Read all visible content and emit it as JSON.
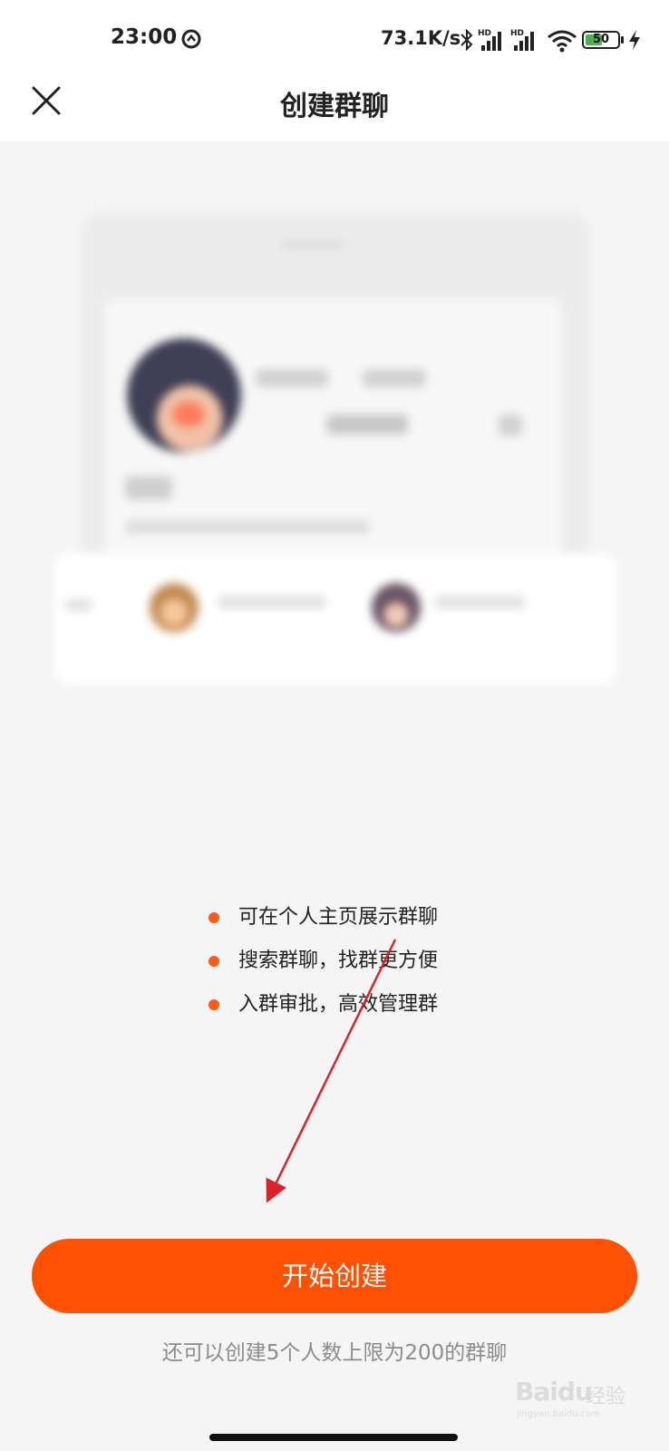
{
  "status_bar": {
    "time": "23:00",
    "net_speed": "73.1K/s",
    "battery": "50",
    "icons": [
      "nfc-icon",
      "bluetooth-icon",
      "hd-signal-icon",
      "hd-signal-icon",
      "wifi-icon",
      "battery-icon",
      "charging-icon"
    ]
  },
  "header": {
    "title": "创建群聊",
    "close_icon": "close-icon"
  },
  "features": [
    "可在个人主页展示群聊",
    "搜索群聊，找群更方便",
    "入群审批，高效管理群"
  ],
  "actions": {
    "start_label": "开始创建",
    "quota_text": "还可以创建5个人数上限为200的群聊"
  },
  "watermark": {
    "brand": "Baidu",
    "brand_cn": "经验",
    "url": "jingyan.baidu.com"
  },
  "colors": {
    "accent": "#fe5104",
    "bullet": "#fe5a1b",
    "annotation_arrow": "#d9222a"
  }
}
